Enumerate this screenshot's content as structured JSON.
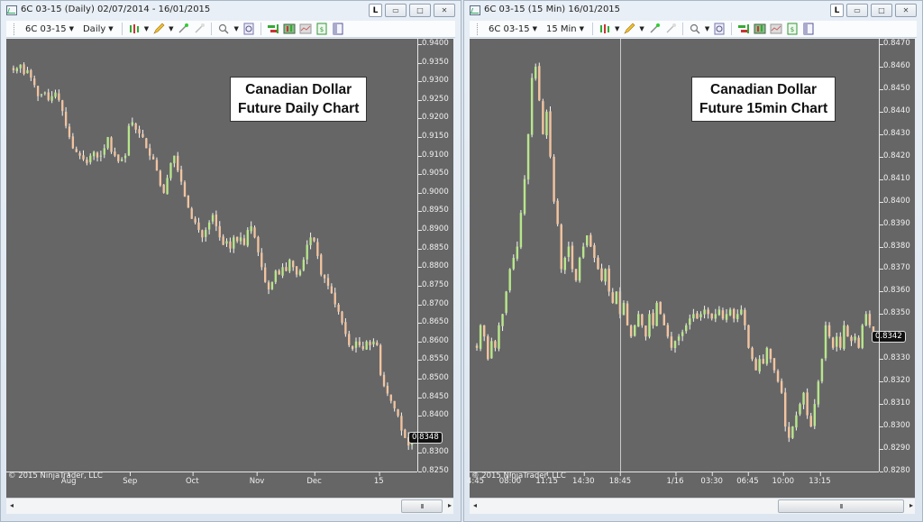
{
  "windows": [
    {
      "id": "left",
      "title": "6C 03-15 (Daily)  02/07/2014 - 16/01/2015",
      "toolbar": {
        "instrument": "6C 03-15",
        "interval": "Daily"
      },
      "title_buttons": {
        "lock": "L",
        "minimize": "▭",
        "maximize": "□",
        "close": "✕"
      },
      "label": [
        "Canadian Dollar",
        "Future Daily Chart"
      ],
      "copyright": "© 2015 NinjaTrader, LLC",
      "last_price": "0.8348",
      "scrollbar_thumb": "III"
    },
    {
      "id": "right",
      "title": "6C 03-15 (15 Min)  16/01/2015",
      "toolbar": {
        "instrument": "6C 03-15",
        "interval": "15 Min"
      },
      "title_buttons": {
        "lock": "L",
        "minimize": "▭",
        "maximize": "□",
        "close": "✕"
      },
      "label": [
        "Canadian Dollar",
        "Future 15min Chart"
      ],
      "copyright": "© 2015 NinjaTrader, LLC",
      "last_price": "0.8342",
      "scrollbar_thumb": "III"
    }
  ],
  "colors": {
    "background": "#666666",
    "up_candle": "#b8e68c",
    "down_candle": "#f2c4a0",
    "wick": "#f5f5f5",
    "axis_text": "#f0f0f0"
  },
  "chart_data": [
    {
      "type": "candlestick",
      "title": "Canadian Dollar Future Daily Chart",
      "instrument": "6C 03-15",
      "interval": "Daily",
      "ylim": [
        0.825,
        0.94
      ],
      "yticks": [
        "0.9400",
        "0.9350",
        "0.9300",
        "0.9250",
        "0.9200",
        "0.9150",
        "0.9100",
        "0.9050",
        "0.9000",
        "0.8950",
        "0.8900",
        "0.8850",
        "0.8800",
        "0.8750",
        "0.8700",
        "0.8650",
        "0.8600",
        "0.8550",
        "0.8500",
        "0.8450",
        "0.8400",
        "0.8300",
        "0.8250"
      ],
      "xticks": [
        {
          "label": "Aug",
          "pos": 0.148
        },
        {
          "label": "Sep",
          "pos": 0.298
        },
        {
          "label": "Oct",
          "pos": 0.45
        },
        {
          "label": "Nov",
          "pos": 0.608
        },
        {
          "label": "Dec",
          "pos": 0.748
        },
        {
          "label": "15",
          "pos": 0.906
        }
      ],
      "close_path": [
        0.933,
        0.9335,
        0.9345,
        0.932,
        0.933,
        0.931,
        0.929,
        0.926,
        0.9265,
        0.927,
        0.925,
        0.926,
        0.927,
        0.925,
        0.922,
        0.918,
        0.915,
        0.912,
        0.911,
        0.91,
        0.909,
        0.908,
        0.91,
        0.911,
        0.9095,
        0.91,
        0.912,
        0.915,
        0.911,
        0.91,
        0.9085,
        0.909,
        0.91,
        0.918,
        0.919,
        0.917,
        0.916,
        0.915,
        0.912,
        0.91,
        0.909,
        0.906,
        0.902,
        0.9,
        0.904,
        0.908,
        0.91,
        0.906,
        0.903,
        0.899,
        0.896,
        0.893,
        0.892,
        0.89,
        0.888,
        0.89,
        0.892,
        0.894,
        0.891,
        0.888,
        0.886,
        0.887,
        0.885,
        0.888,
        0.887,
        0.888,
        0.886,
        0.89,
        0.891,
        0.888,
        0.884,
        0.88,
        0.876,
        0.874,
        0.876,
        0.879,
        0.878,
        0.88,
        0.879,
        0.882,
        0.88,
        0.878,
        0.879,
        0.882,
        0.886,
        0.888,
        0.887,
        0.883,
        0.878,
        0.877,
        0.875,
        0.873,
        0.87,
        0.868,
        0.865,
        0.862,
        0.859,
        0.858,
        0.86,
        0.859,
        0.858,
        0.86,
        0.859,
        0.86,
        0.859,
        0.851,
        0.848,
        0.846,
        0.844,
        0.842,
        0.84,
        0.836,
        0.834,
        0.832,
        0.8348
      ]
    },
    {
      "type": "candlestick",
      "title": "Canadian Dollar Future 15min Chart",
      "instrument": "6C 03-15",
      "interval": "15 Min",
      "ylim": [
        0.828,
        0.847
      ],
      "yticks": [
        "0.8470",
        "0.8460",
        "0.8450",
        "0.8440",
        "0.8430",
        "0.8420",
        "0.8410",
        "0.8400",
        "0.8390",
        "0.8380",
        "0.8370",
        "0.8360",
        "0.8350",
        "0.8330",
        "0.8320",
        "0.8310",
        "0.8300",
        "0.8290",
        "0.8280"
      ],
      "xticks": [
        {
          "label": "4:45",
          "pos": 0.01
        },
        {
          "label": "08:00",
          "pos": 0.095
        },
        {
          "label": "11:15",
          "pos": 0.185
        },
        {
          "label": "14:30",
          "pos": 0.275
        },
        {
          "label": "18:45",
          "pos": 0.365
        },
        {
          "label": "1/16",
          "pos": 0.5
        },
        {
          "label": "03:30",
          "pos": 0.59
        },
        {
          "label": "06:45",
          "pos": 0.678
        },
        {
          "label": "10:00",
          "pos": 0.765
        },
        {
          "label": "13:15",
          "pos": 0.855
        }
      ],
      "session_break_pos": 0.365,
      "close_path": [
        0.8335,
        0.8345,
        0.834,
        0.833,
        0.8338,
        0.8335,
        0.8345,
        0.835,
        0.836,
        0.837,
        0.8375,
        0.838,
        0.8395,
        0.841,
        0.843,
        0.8455,
        0.846,
        0.8445,
        0.843,
        0.844,
        0.842,
        0.84,
        0.839,
        0.837,
        0.8375,
        0.838,
        0.837,
        0.8365,
        0.8375,
        0.838,
        0.8385,
        0.838,
        0.8375,
        0.837,
        0.8365,
        0.837,
        0.836,
        0.8355,
        0.836,
        0.835,
        0.8355,
        0.8345,
        0.834,
        0.8345,
        0.835,
        0.8345,
        0.834,
        0.835,
        0.8345,
        0.8355,
        0.835,
        0.8345,
        0.834,
        0.8335,
        0.8338,
        0.834,
        0.8342,
        0.8345,
        0.8348,
        0.835,
        0.8348,
        0.835,
        0.8352,
        0.835,
        0.8348,
        0.835,
        0.8352,
        0.8348,
        0.835,
        0.8352,
        0.8348,
        0.835,
        0.8352,
        0.8345,
        0.8335,
        0.833,
        0.8325,
        0.833,
        0.8328,
        0.8335,
        0.833,
        0.8325,
        0.832,
        0.8315,
        0.83,
        0.8295,
        0.83,
        0.8305,
        0.831,
        0.8315,
        0.8305,
        0.83,
        0.831,
        0.832,
        0.833,
        0.8345,
        0.834,
        0.8335,
        0.834,
        0.8335,
        0.8345,
        0.834,
        0.8338,
        0.834,
        0.8335,
        0.8345,
        0.835,
        0.8345,
        0.8342
      ]
    }
  ]
}
